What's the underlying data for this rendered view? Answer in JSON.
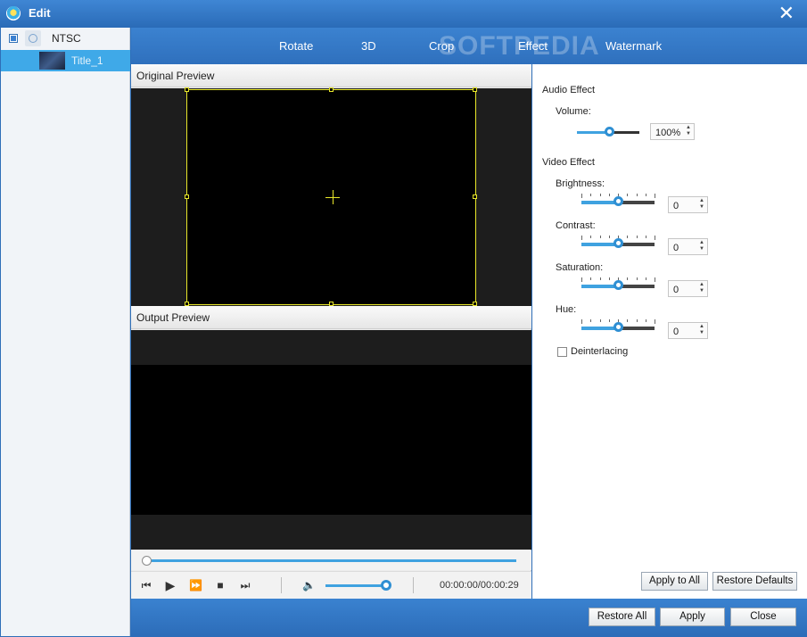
{
  "window": {
    "title": "Edit",
    "close_glyph": "✕"
  },
  "tree": {
    "items": [
      {
        "label": "NTSC"
      },
      {
        "label": "Title_1"
      }
    ]
  },
  "tabs": [
    "Rotate",
    "3D",
    "Crop",
    "Effect",
    "Watermark"
  ],
  "watermark_text": "SOFTPEDIA",
  "preview": {
    "original_label": "Original Preview",
    "output_label": "Output Preview"
  },
  "player": {
    "time": "00:00:00/00:00:29",
    "volume_level": 0.9,
    "seek_position": 0.0
  },
  "effects": {
    "audio_heading": "Audio Effect",
    "volume_label": "Volume:",
    "volume_value": "100%",
    "video_heading": "Video Effect",
    "brightness_label": "Brightness:",
    "brightness_value": "0",
    "contrast_label": "Contrast:",
    "contrast_value": "0",
    "saturation_label": "Saturation:",
    "saturation_value": "0",
    "hue_label": "Hue:",
    "hue_value": "0",
    "deinterlacing_label": "Deinterlacing",
    "deinterlacing_checked": false
  },
  "buttons": {
    "apply_to_all": "Apply to All",
    "restore_defaults": "Restore Defaults",
    "restore_all": "Restore All",
    "apply": "Apply",
    "close": "Close"
  },
  "colors": {
    "accent": "#3fa2e0",
    "titlebar": "#2f70bd",
    "crop_frame": "#e9e82a"
  }
}
